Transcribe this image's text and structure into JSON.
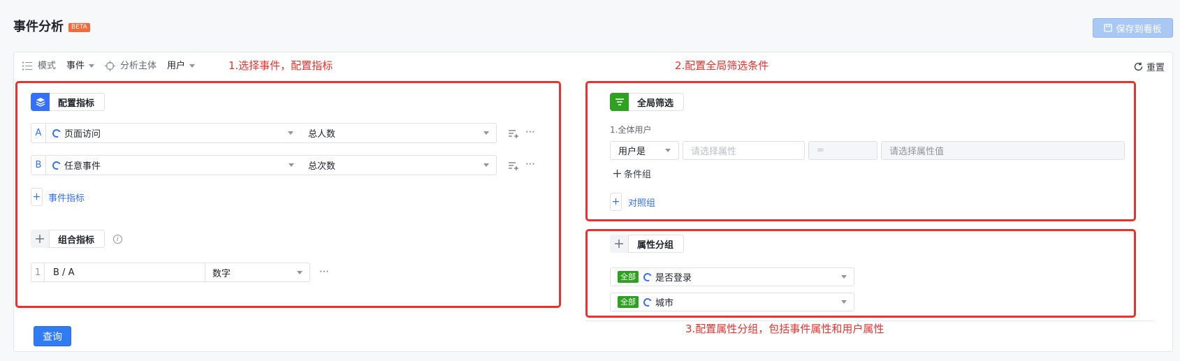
{
  "header": {
    "title": "事件分析",
    "beta": "BETA",
    "save_label": "保存到看板"
  },
  "toolbar": {
    "mode_label": "模式",
    "mode_value": "事件",
    "subject_label": "分析主体",
    "subject_value": "用户",
    "reset_label": "重置"
  },
  "annotations": {
    "step1": "1.选择事件，配置指标",
    "step2": "2.配置全局筛选条件",
    "step3": "3.配置属性分组，包括事件属性和用户属性"
  },
  "metrics": {
    "title": "配置指标",
    "rows": [
      {
        "letter": "A",
        "event": "页面访问",
        "measure": "总人数"
      },
      {
        "letter": "B",
        "event": "任意事件",
        "measure": "总次数"
      }
    ],
    "add_label": "事件指标"
  },
  "combo": {
    "title": "组合指标",
    "index": "1",
    "formula": "B / A",
    "format": "数字"
  },
  "filter": {
    "title": "全局筛选",
    "scope": "1.全体用户",
    "subject": "用户是",
    "attr_placeholder": "请选择属性",
    "op": "=",
    "value_placeholder": "请选择属性值",
    "add_group": "条件组",
    "compare_group": "对照组"
  },
  "grouping": {
    "title": "属性分组",
    "items": [
      {
        "tag": "全部",
        "label": "是否登录"
      },
      {
        "tag": "全部",
        "label": "城市"
      }
    ]
  },
  "actions": {
    "query_label": "查询"
  },
  "colors": {
    "accent": "#3370ff",
    "annotation": "#e8322e",
    "tag_green": "#2ea121"
  }
}
